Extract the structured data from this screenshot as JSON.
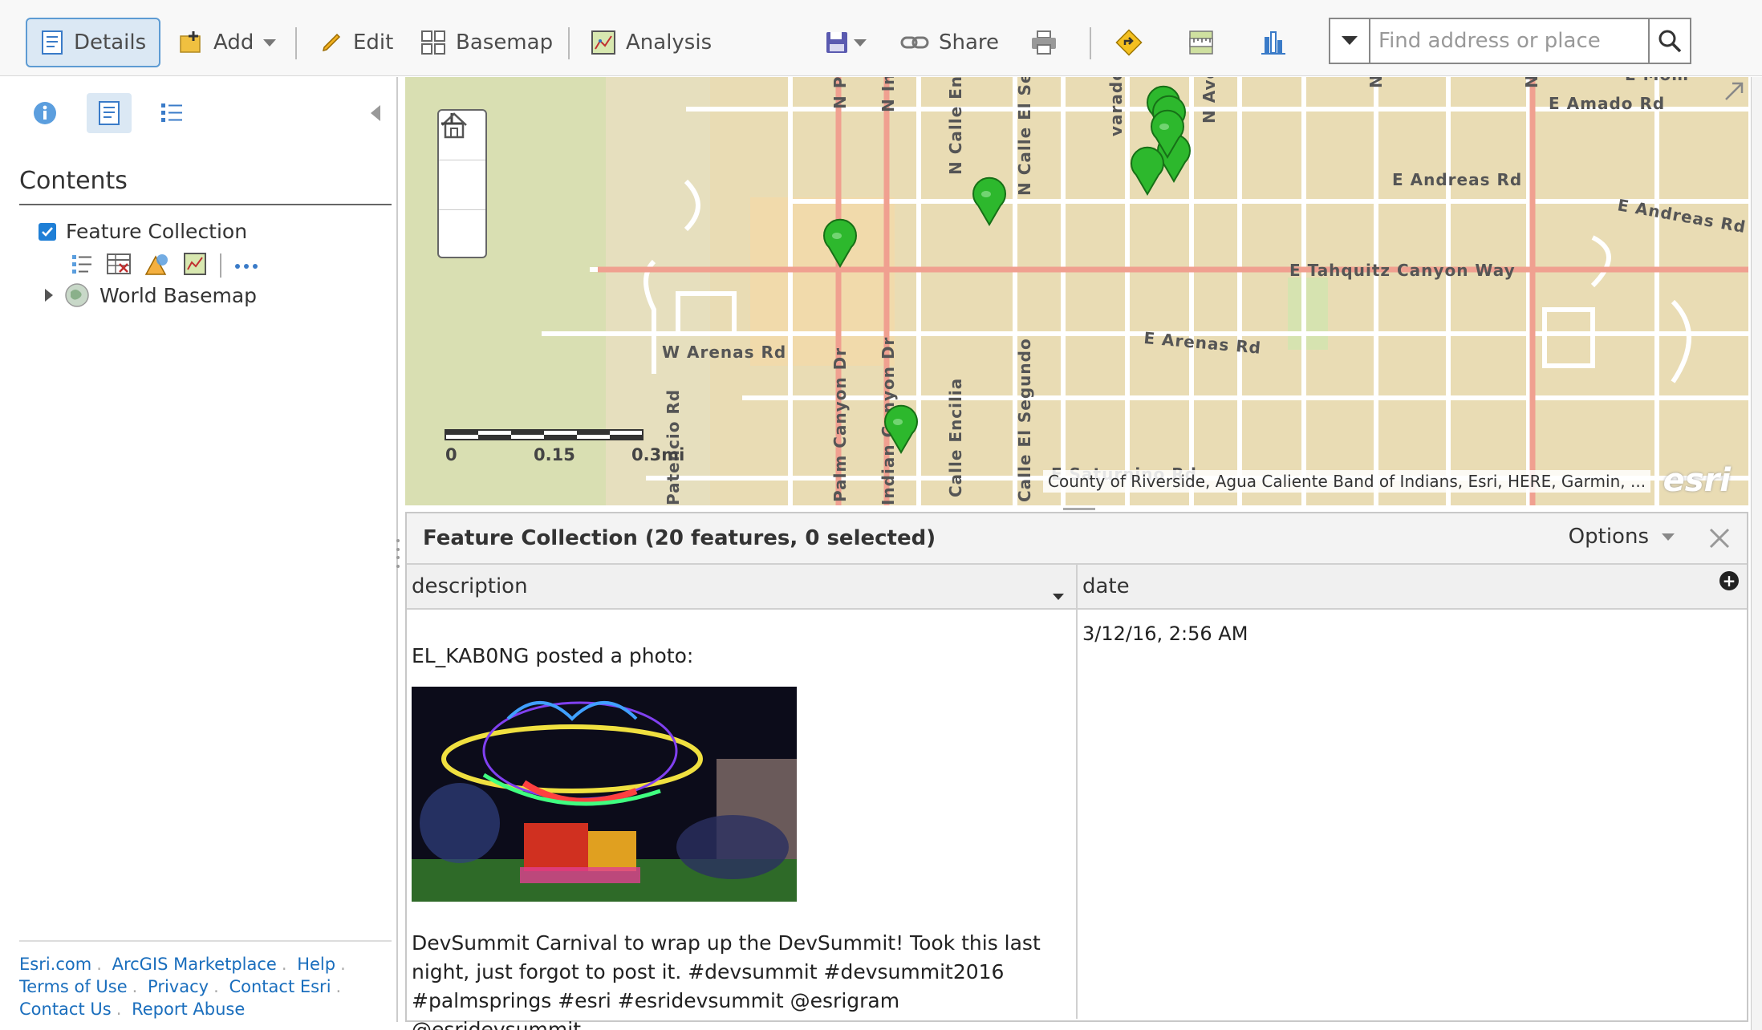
{
  "toolbar": {
    "details_label": "Details",
    "add_label": "Add",
    "edit_label": "Edit",
    "basemap_label": "Basemap",
    "analysis_label": "Analysis",
    "share_label": "Share"
  },
  "search": {
    "placeholder": "Find address or place"
  },
  "sidebar": {
    "contents_title": "Contents",
    "layers": [
      {
        "label": "Feature Collection",
        "checked": true
      },
      {
        "label": "World Basemap"
      }
    ],
    "footer": {
      "links": [
        "Esri.com",
        "ArcGIS Marketplace",
        "Help",
        "Terms of Use",
        "Privacy",
        "Contact Esri",
        "Contact Us",
        "Report Abuse"
      ]
    }
  },
  "map": {
    "road_labels": {
      "amado": "E Amado Rd",
      "andreas1": "E Andreas Rd",
      "andreas2": "E Andreas Rd",
      "tahquitz": "E Tahquitz Canyon Way",
      "arenas_e": "E Arenas Rd",
      "arenas_w": "W Arenas Rd",
      "saturnino": "E Saturnino Rd",
      "palm_canyon": "Palm Canyon Dr",
      "indian_canyon": "Indian Canyon Dr",
      "calle_encilia": "Calle Encilia",
      "calle_el_segundo": "Calle El Segundo",
      "n_calle_en": "N Calle En",
      "n_calle_el_se": "N Calle El Se",
      "patencio": "Patencio Rd",
      "alvarado": "varado",
      "n_av": "N Ave",
      "n_p": "N P",
      "n_in": "N In",
      "n1": "N",
      "n2": "N",
      "mom": "E Mom"
    },
    "scale": {
      "labels": [
        "0",
        "0.15",
        "0.3mi"
      ]
    },
    "attribution": "County of Riverside, Agua Caliente Band of Indians, Esri, HERE, Garmin, ...",
    "logo": "esri",
    "marker_color": "#2db82d"
  },
  "table": {
    "title": "Feature Collection (20 features, 0 selected)",
    "options_label": "Options",
    "columns": [
      "description",
      "date"
    ],
    "rows": [
      {
        "user": "EL_KAB0NG",
        "posted": "posted a photo:",
        "caption": "DevSummit Carnival to wrap up the DevSummit! Took this last night, just forgot to post it. #devsummit #devsummit2016 #palmsprings #esri #esridevsummit @esrigram @esridevsummit",
        "date": "3/12/16, 2:56 AM"
      }
    ]
  }
}
